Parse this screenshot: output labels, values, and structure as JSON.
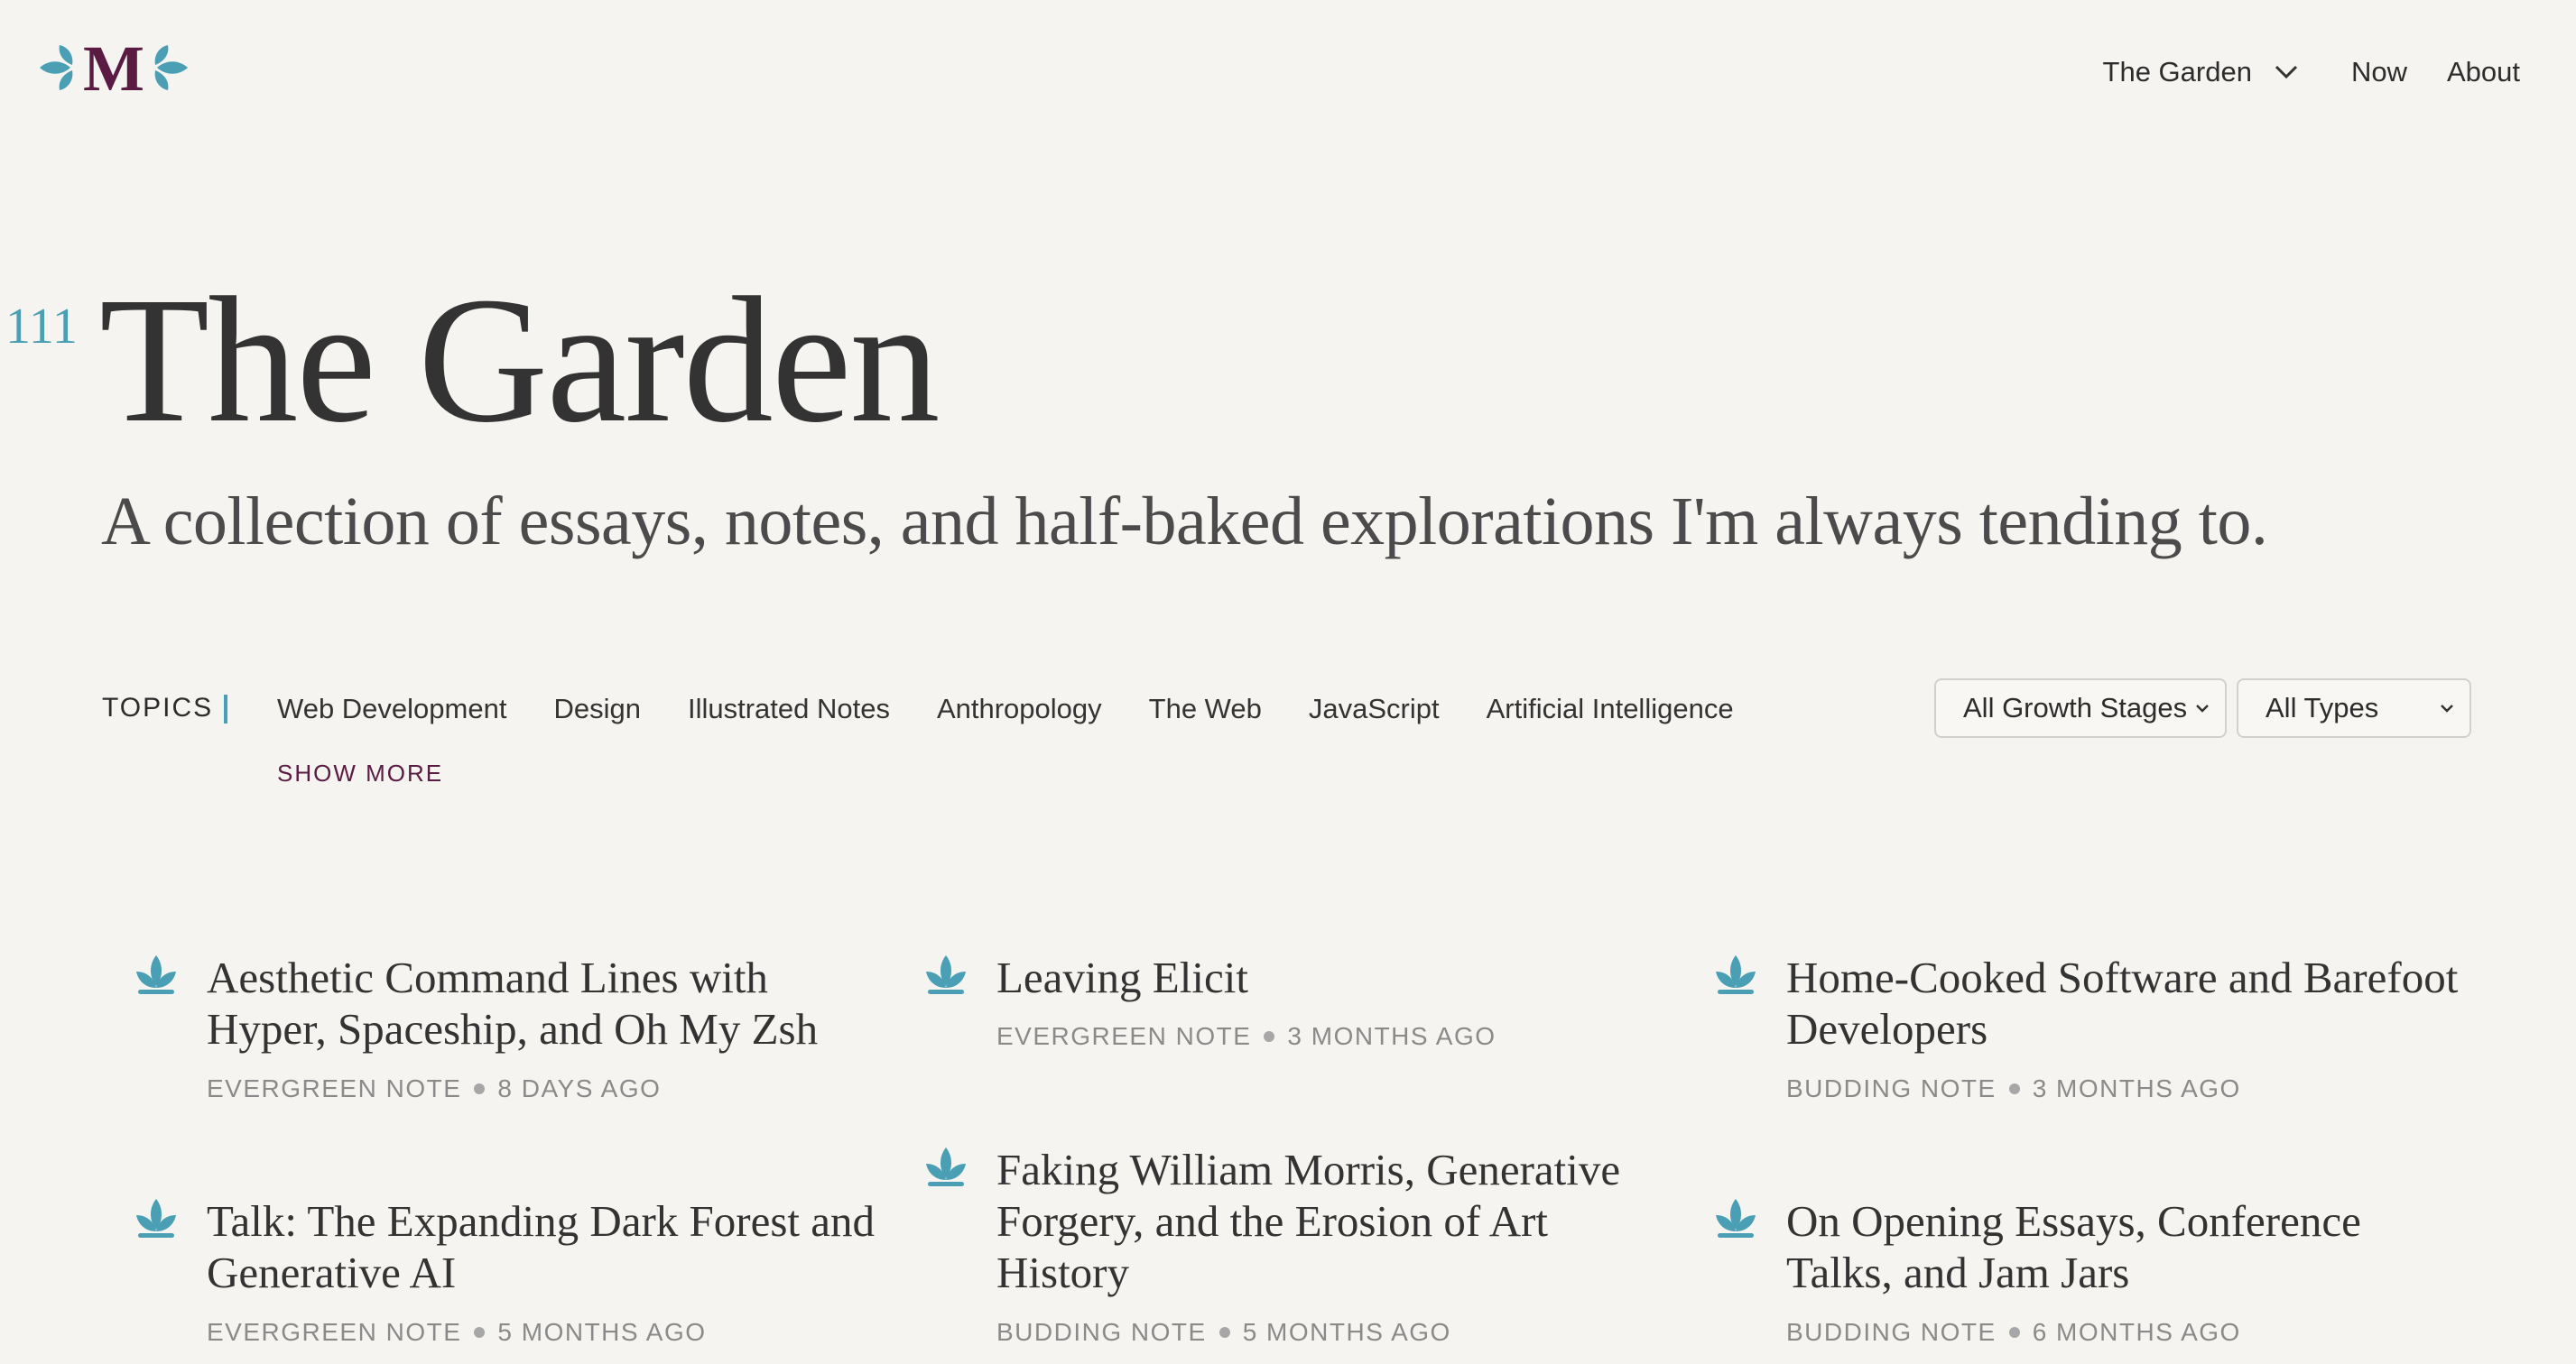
{
  "header": {
    "logo_letter": "M",
    "nav": [
      {
        "label": "The Garden",
        "has_dropdown": true
      },
      {
        "label": "Now"
      },
      {
        "label": "About"
      }
    ]
  },
  "hero": {
    "count": "111",
    "title": "The Garden",
    "subtitle": "A collection of essays, notes, and half-baked explorations I'm always tending to."
  },
  "topics": {
    "label": "TOPICS",
    "items": [
      "Web Development",
      "Design",
      "Illustrated Notes",
      "Anthropology",
      "The Web",
      "JavaScript",
      "Artificial Intelligence"
    ],
    "show_more": "SHOW MORE"
  },
  "filters": {
    "growth_stage": "All Growth Stages",
    "type": "All Types"
  },
  "notes": [
    {
      "title": "Aesthetic Command Lines with Hyper, Spaceship, and Oh My Zsh",
      "stage": "EVERGREEN NOTE",
      "age": "8 DAYS AGO"
    },
    {
      "title": "Leaving Elicit",
      "stage": "EVERGREEN NOTE",
      "age": "3 MONTHS AGO"
    },
    {
      "title": "Home-Cooked Software and Barefoot Developers",
      "stage": "BUDDING NOTE",
      "age": "3 MONTHS AGO"
    },
    {
      "title": "Talk: The Expanding Dark Forest and Generative AI",
      "stage": "EVERGREEN NOTE",
      "age": "5 MONTHS AGO"
    },
    {
      "title": "Faking William Morris, Generative Forgery, and the Erosion of Art History",
      "stage": "BUDDING NOTE",
      "age": "5 MONTHS AGO"
    },
    {
      "title": "On Opening Essays, Conference Talks, and Jam Jars",
      "stage": "BUDDING NOTE",
      "age": "6 MONTHS AGO"
    }
  ],
  "colors": {
    "accent_teal": "#4a9fb5",
    "brand_plum": "#5a1a42",
    "background": "#f5f4f1"
  },
  "icons": [
    "leaf-sprout-icon",
    "chevron-down-icon"
  ]
}
